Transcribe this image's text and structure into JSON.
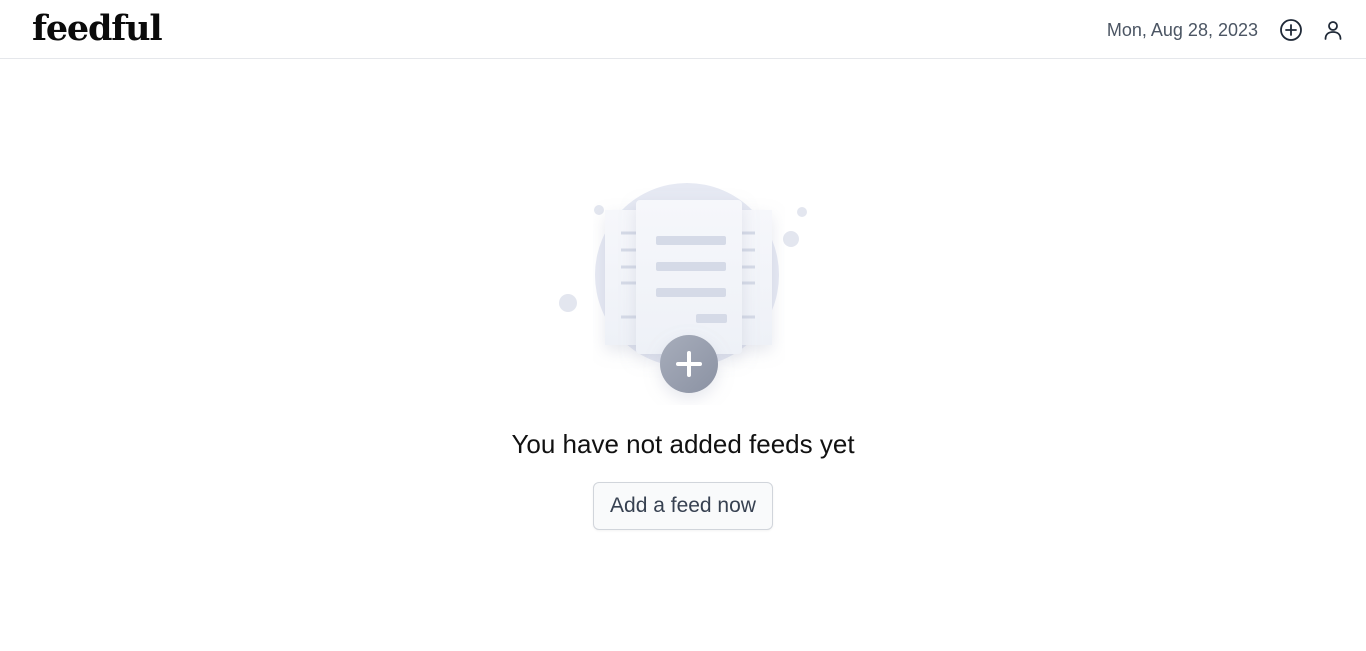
{
  "header": {
    "logo": "feedful",
    "date": "Mon, Aug 28, 2023",
    "icons": [
      "add-circle-icon",
      "user-icon"
    ]
  },
  "empty_state": {
    "illustration": "empty-feed-illustration",
    "message": "You have not added feeds yet",
    "button_label": "Add a feed now"
  },
  "colors": {
    "border": "#e5e7eb",
    "text_muted": "#4b5563",
    "illustration_circle": "#e5e8f2",
    "illustration_paper": "#f3f5fa",
    "illustration_lines": "#d4d9e6",
    "plus_badge": "#9ca3b3"
  }
}
